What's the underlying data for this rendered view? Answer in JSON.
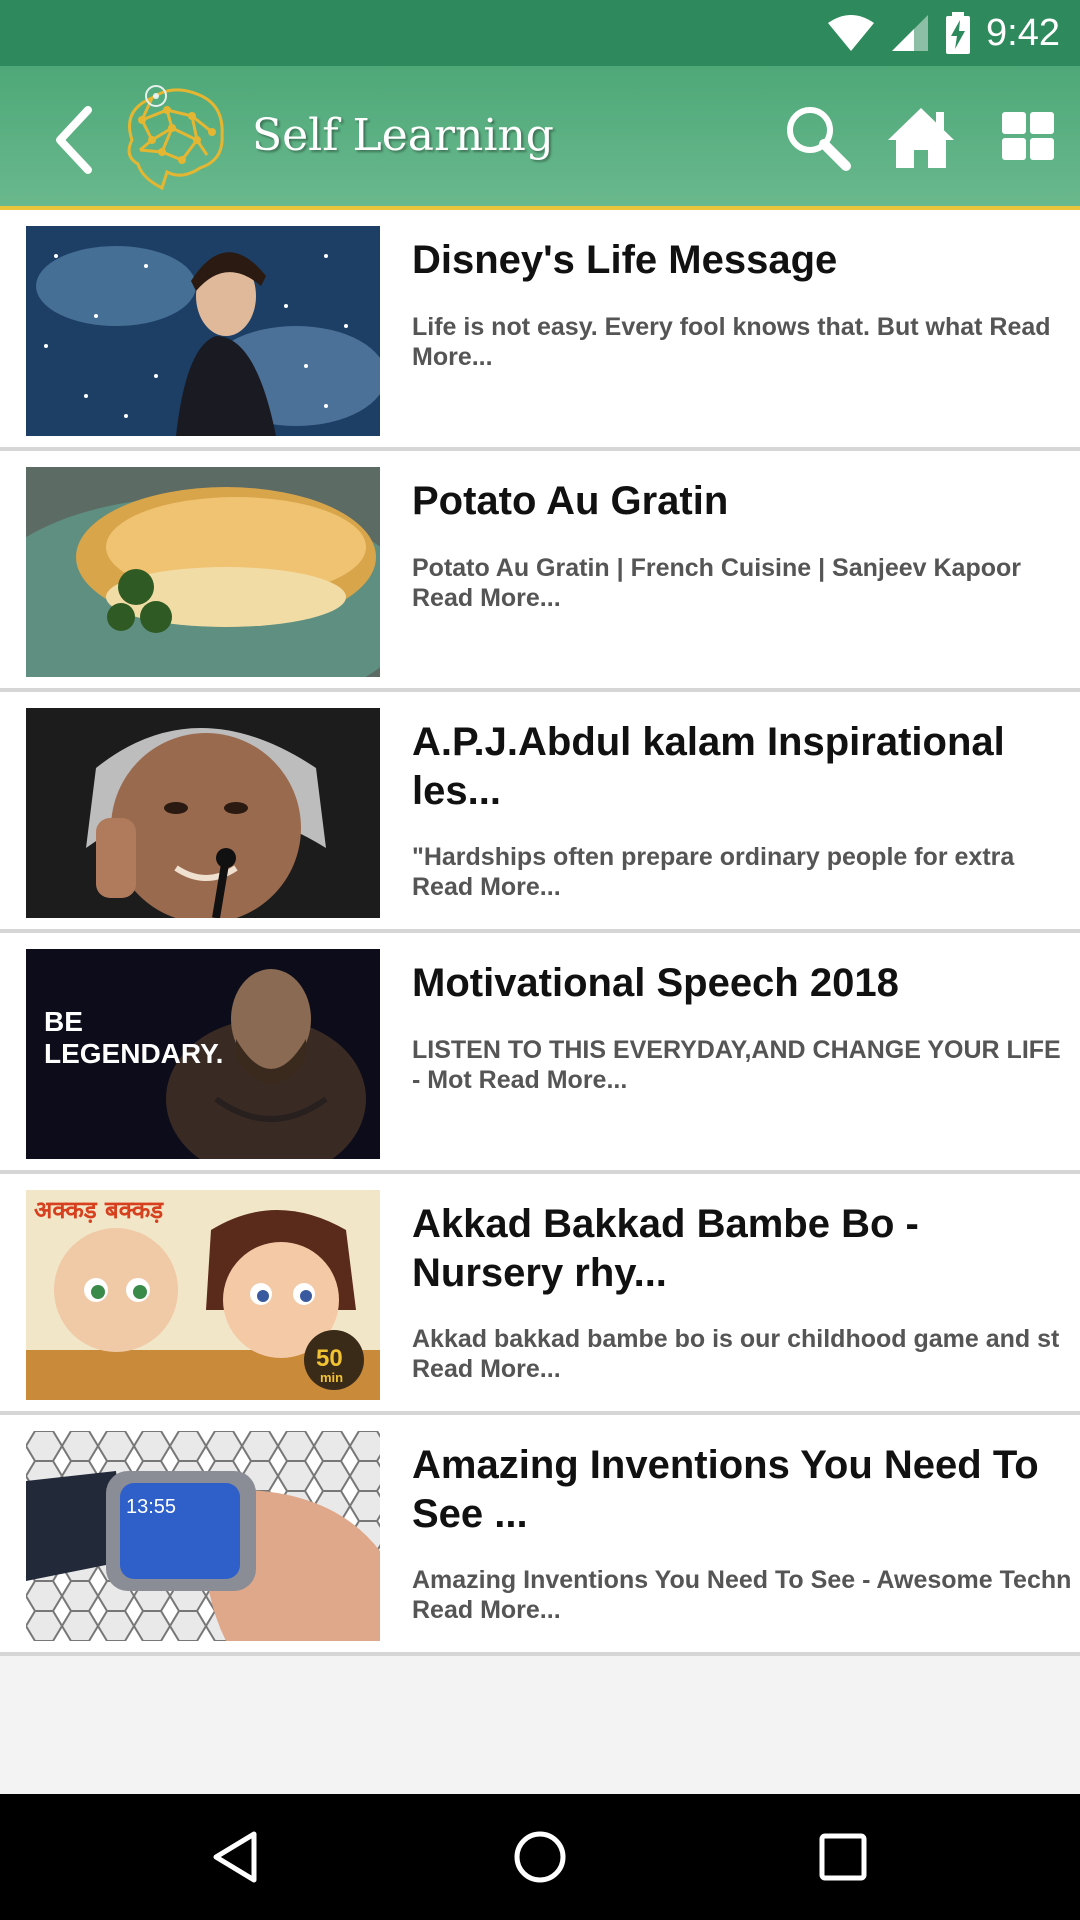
{
  "status_bar": {
    "time": "9:42"
  },
  "app_bar": {
    "title": "Self Learning",
    "icons": [
      "back-arrow-icon",
      "brain-logo-icon",
      "search-icon",
      "home-icon",
      "grid-icon"
    ]
  },
  "items": [
    {
      "title": "Disney's Life Message",
      "description": "Life is not easy. Every fool knows that. But what  Read More...",
      "thumbnail": "animated-prince-thumbnail"
    },
    {
      "title": "Potato Au Gratin",
      "description": "Potato Au Gratin | French Cuisine | Sanjeev Kapoor Read More...",
      "thumbnail": "potato-dish-thumbnail"
    },
    {
      "title": "A.P.J.Abdul kalam Inspirational les...",
      "description": "\"Hardships often prepare ordinary people for extra Read More...",
      "thumbnail": "speaker-portrait-thumbnail"
    },
    {
      "title": " Motivational Speech 2018",
      "description": "LISTEN TO THIS EVERYDAY,AND CHANGE YOUR LIFE - Mot Read More...",
      "thumbnail": "be-legendary-thumbnail",
      "thumbnail_text": [
        "BE",
        "LEGENDARY."
      ]
    },
    {
      "title": "Akkad Bakkad Bambe Bo - Nursery rhy...",
      "description": "Akkad bakkad bambe bo is our childhood game and st Read More...",
      "thumbnail": "cartoon-kids-thumbnail",
      "thumbnail_text": [
        "अक्कड़ बक्कड़",
        "50",
        "min"
      ]
    },
    {
      "title": "Amazing Inventions You Need To See ...",
      "description": "Amazing Inventions You Need To See - Awesome Techn Read More...",
      "thumbnail": "wrist-device-thumbnail",
      "thumbnail_text": [
        "13:55"
      ]
    }
  ],
  "nav_bar": {
    "icons": [
      "nav-back-icon",
      "nav-home-icon",
      "nav-recents-icon"
    ]
  },
  "colors": {
    "status_bar": "#2e8a5c",
    "app_bar": "#5caf83",
    "accent_line": "#e8c53a"
  }
}
